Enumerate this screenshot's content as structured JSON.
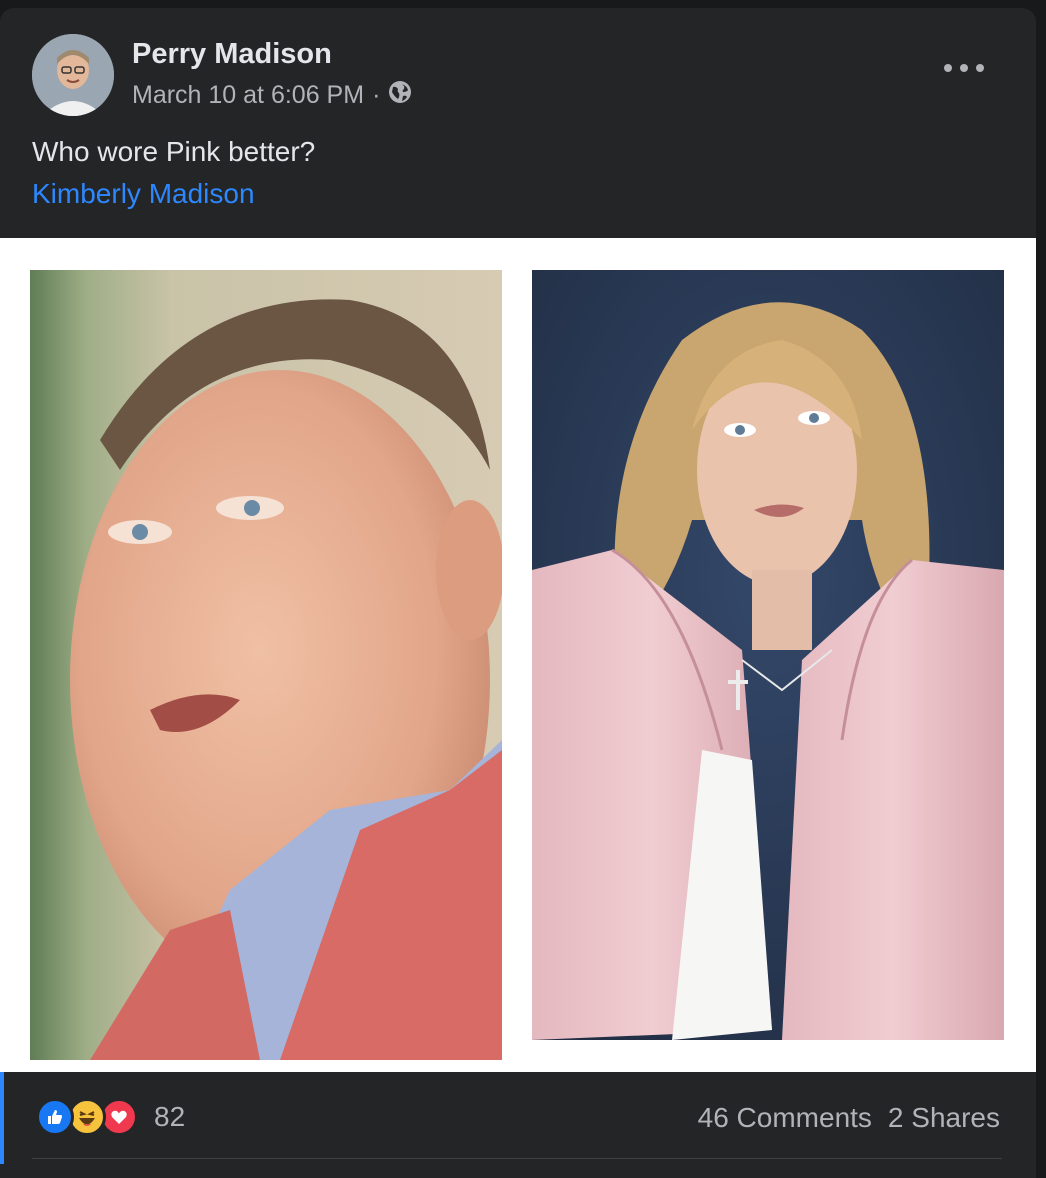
{
  "post": {
    "author": "Perry Madison",
    "timestamp": "March 10 at 6:06 PM",
    "separator": "·",
    "audience_icon": "globe-icon",
    "text": "Who wore Pink better?",
    "mention": "Kimberly Madison"
  },
  "reactions": {
    "icons": [
      "like-icon",
      "haha-icon",
      "love-icon"
    ],
    "count": "82"
  },
  "stats": {
    "comments": "46 Comments",
    "shares": "2 Shares"
  },
  "colors": {
    "background": "#18191a",
    "card": "#242526",
    "primary_text": "#e4e6eb",
    "secondary_text": "#b0b3b8",
    "link": "#2d88ff"
  }
}
